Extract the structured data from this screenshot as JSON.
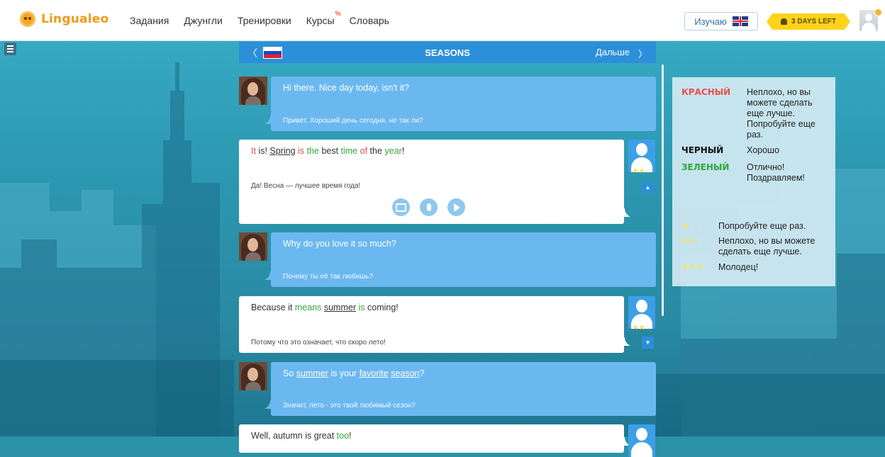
{
  "header": {
    "logo": "Lingualeo",
    "nav": [
      {
        "label": "Задания"
      },
      {
        "label": "Джунгли"
      },
      {
        "label": "Тренировки"
      },
      {
        "label": "Курсы",
        "badge": "%"
      },
      {
        "label": "Словарь"
      }
    ],
    "learning_button": "Изучаю",
    "days_left": "3 DAYS LEFT"
  },
  "lesson": {
    "back": "〈",
    "title": "SEASONS",
    "next_label": "Дальше",
    "next_arrow": "〉"
  },
  "messages": [
    {
      "speaker": "npc",
      "en": "Hi there. Nice day today, isn't it?",
      "ru": "Привет. Хороший день сегодня, не так ли?"
    },
    {
      "speaker": "user",
      "en": "It is! Spring is the best time of the year!",
      "ru": "Да! Весна — лучшее время года!",
      "stars": 2
    },
    {
      "speaker": "npc",
      "en": "Why do you love it so much?",
      "ru": "Почему ты её так любишь?"
    },
    {
      "speaker": "user",
      "en": "Because it means summer is coming!",
      "ru": "Потому что это означает, что скоро лето!",
      "stars": 2
    },
    {
      "speaker": "npc",
      "en": "So summer is your favorite season?",
      "ru": "Значит, лето - это твой любимый сезон?"
    },
    {
      "speaker": "user",
      "en": "Well, autumn is great too!",
      "ru": ""
    }
  ],
  "legend": {
    "colors": [
      {
        "key": "КРАСНЫЙ",
        "desc": "Неплохо, но вы можете сделать еще лучше. Попробуйте еще раз."
      },
      {
        "key": "ЧЕРНЫЙ",
        "desc": "Хорошо"
      },
      {
        "key": "ЗЕЛЕНЫЙ",
        "desc": "Отлично! Поздравляем!"
      }
    ],
    "stars": [
      {
        "count": 1,
        "desc": "Попробуйте еще раз."
      },
      {
        "count": 2,
        "desc": "Неплохо, но вы можете сделать еще лучше."
      },
      {
        "count": 3,
        "desc": "Молодец!"
      }
    ]
  },
  "colors": {
    "brand": "#f09a1a",
    "header_blue": "#2b8fd9",
    "npc_bubble": "#6bb8f0",
    "word_red": "#e84a4a",
    "word_green": "#35a83a",
    "badge_yellow": "#ffd21a"
  }
}
